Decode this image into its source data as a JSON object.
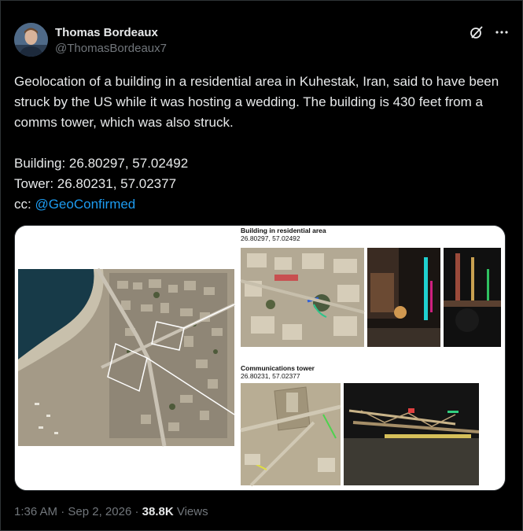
{
  "author": {
    "display_name": "Thomas Bordeaux",
    "handle": "@ThomasBordeaux7"
  },
  "icons": {
    "grok": "grok-icon",
    "more": "more-icon"
  },
  "tweet": {
    "text_main": "Geolocation of a building in a residential area in Kuhestak, Iran, said to have been struck by the US while it was hosting a wedding. The building is 430 feet from a comms tower, which was also struck.",
    "building_line": "Building: 26.80297, 57.02492",
    "tower_line": "Tower: 26.80231, 57.02377",
    "cc_prefix": "cc: ",
    "cc_mention": "@GeoConfirmed"
  },
  "media": {
    "building_caption": "Building in residential area",
    "building_coords": "26.80297, 57.02492",
    "tower_caption": "Communications tower",
    "tower_coords": "26.80231, 57.02377"
  },
  "footer": {
    "time": "1:36 AM",
    "sep1": " · ",
    "date": "Sep 2, 2026",
    "sep2": " · ",
    "views_count": "38.8K",
    "views_label": " Views"
  },
  "colors": {
    "background": "#000000",
    "text": "#e7e9ea",
    "muted": "#71767b",
    "link": "#1d9bf0",
    "border": "#2f3336"
  }
}
